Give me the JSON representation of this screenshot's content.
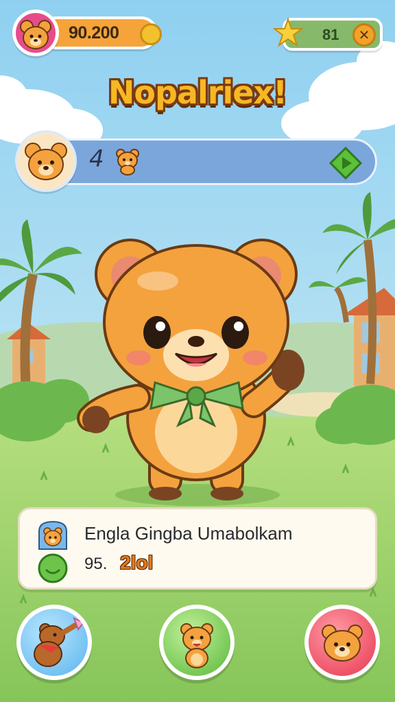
{
  "hud": {
    "coins": "90.200",
    "level": "81",
    "close_glyph": "✕",
    "icons": {
      "avatar": "bear-avatar-icon",
      "coin": "coin-icon",
      "star": "star-icon",
      "close": "close-icon"
    }
  },
  "title": "Nopalriex!",
  "progress": {
    "count": "4",
    "icons": {
      "avatar": "bear-face-icon",
      "mini": "mini-bear-icon",
      "play": "play-icon"
    }
  },
  "card": {
    "line1": "Engla Gingba Umabolkam",
    "line2_prefix": "95.",
    "line2_value": "2lol",
    "icons": {
      "first": "bear-profile-icon",
      "second": "green-smiley-icon"
    }
  },
  "buttons": [
    {
      "name": "dance-bear-button",
      "icon": "dancing-bear-icon",
      "color": "#5ab4ec"
    },
    {
      "name": "happy-bear-button",
      "icon": "happy-bear-icon",
      "color": "#58b83a"
    },
    {
      "name": "bear-face-button",
      "icon": "bear-face-icon",
      "color": "#e8374e"
    }
  ],
  "colors": {
    "sky": "#9fd6f0",
    "grass": "#9ed06a",
    "bear": "#f4a23e",
    "title": "#f6b824",
    "bar": "#7aa6dc"
  }
}
